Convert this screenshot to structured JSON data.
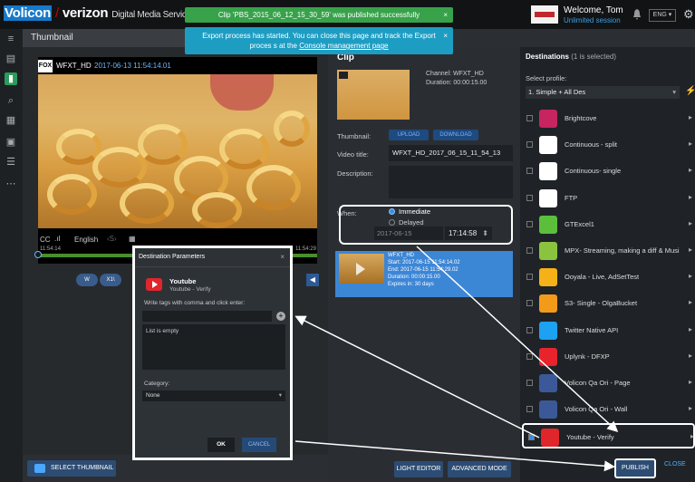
{
  "brand": {
    "name1": "Volicon",
    "name2": "verizon",
    "suffix": "Digital Media Service"
  },
  "toasts": {
    "success": "Clip 'PBS_2015_06_12_15_30_59' was published successfully",
    "info_pre": "Export process has started. You can close this page and track the Export proces s at the ",
    "info_link": "Console management page",
    "close": "×"
  },
  "user": {
    "welcome": "Welcome, Tom",
    "session": "Unlimited session",
    "lang": "ENG ▾"
  },
  "nav": {
    "icons": [
      "menu-icon",
      "library-icon",
      "bookmark-icon",
      "search-icon",
      "calendar-icon",
      "monitor-icon",
      "list-icon",
      "grid-icon"
    ]
  },
  "thumbnail": {
    "header": "Thumbnail",
    "channel_logo": "FOX 25",
    "channel": "WFXT_HD",
    "timestamp": "2017-06-13 11:54:14.01",
    "cc": "CC",
    "lang": "English",
    "time_start": "11:54:14",
    "time_end": "11:54:29",
    "controls": [
      "W",
      "X1\\"
    ],
    "select_label": "SELECT THUMBNAIL"
  },
  "clip": {
    "header": "Clip",
    "channel": "Channel: WFXT_HD",
    "duration": "Duration: 00:00:15.00",
    "thumb_label": "Thumbnail:",
    "upload": "UPLOAD",
    "download": "DOWNLOAD",
    "video_title_label": "Video title:",
    "video_title": "WFXT_HD_2017_06_15_11_54_13",
    "desc_label": "Description:",
    "when_label": "When:",
    "immediate": "Immediate",
    "delayed": "Delayed",
    "date": "2017-06-15",
    "time": "17:14:58",
    "sched": {
      "l1": "WFXT_HD",
      "l2": "Start: 2017-06-15 11:54:14.02",
      "l3": "End: 2017-06-15 11:54:29.02",
      "l4": "Duration: 00:00:15.00",
      "l5": "Expires in: 30 days"
    },
    "light_editor": "LIGHT EDITOR",
    "advanced_mode": "ADVANCED MODE"
  },
  "destinations": {
    "header": "Destinations",
    "count": "(1 is selected)",
    "profile_label": "Select profile:",
    "profile": "1. Simple + All Des",
    "items": [
      {
        "name": "Brightcove",
        "icon": "brightcove-icon",
        "color": "#c8245f"
      },
      {
        "name": "Continuous - split",
        "icon": "cloud-upload-icon",
        "color": "#ffffff"
      },
      {
        "name": "Continuous- single",
        "icon": "cloud-upload-icon",
        "color": "#ffffff"
      },
      {
        "name": "FTP",
        "icon": "ftp-icon",
        "color": "#ffffff"
      },
      {
        "name": "GTExcel1",
        "icon": "excel-icon",
        "color": "#5bbf3c"
      },
      {
        "name": "MPX- Streaming, making a diff & Musi",
        "icon": "mpx-icon",
        "color": "#8ac43f"
      },
      {
        "name": "Ooyala - Live, AdSetTest",
        "icon": "ooyala-icon",
        "color": "#f5b117"
      },
      {
        "name": "S3- Single - OlgaBucket",
        "icon": "s3-icon",
        "color": "#f29a1a"
      },
      {
        "name": "Twitter Native API",
        "icon": "twitter-icon",
        "color": "#1da1f2"
      },
      {
        "name": "Uplynk - DFXP",
        "icon": "uplynk-icon",
        "color": "#e8232c"
      },
      {
        "name": "Volicon Qa Ori - Page",
        "icon": "facebook-icon",
        "color": "#3b5998"
      },
      {
        "name": "Volicon Qa Ori - Wall",
        "icon": "facebook-icon",
        "color": "#3b5998"
      },
      {
        "name": "Youtube - Verify",
        "icon": "youtube-icon",
        "color": "#e0262b"
      }
    ],
    "publish": "PUBLISH",
    "close": "CLOSE"
  },
  "dialog": {
    "title": "Destination Parameters",
    "close": "×",
    "dest_name": "Youtube",
    "dest_sub": "Youtube - Verify",
    "tags_label": "Write tags with comma and click enter:",
    "list_empty": "List is empty",
    "category_label": "Category:",
    "category": "None",
    "ok": "OK",
    "cancel": "CANCEL"
  }
}
